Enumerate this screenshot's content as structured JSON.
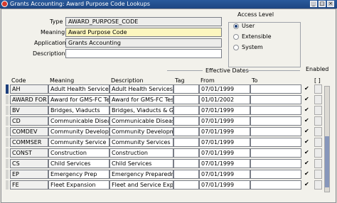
{
  "window": {
    "title": "Grants Accounting: Award Purpose Code Lookups"
  },
  "header": {
    "type_label": "Type",
    "type_value": "AWARD_PURPOSE_CODE",
    "meaning_label": "Meaning",
    "meaning_value": "Award Purpose Code",
    "application_label": "Application",
    "application_value": "Grants Accounting",
    "description_label": "Description",
    "description_value": ""
  },
  "access_level": {
    "title": "Access Level",
    "options": [
      "User",
      "Extensible",
      "System"
    ],
    "selected": "User"
  },
  "table": {
    "group_labels": {
      "effective_dates": "Effective Dates",
      "enabled": "Enabled"
    },
    "columns": {
      "code": "Code",
      "meaning": "Meaning",
      "description": "Description",
      "tag": "Tag",
      "from": "From",
      "to": "To",
      "extra": "[ ]"
    },
    "rows": [
      {
        "code": "AH",
        "meaning": "Adult Health Services",
        "description": "Adult Health Services",
        "tag": "",
        "from": "07/01/1999",
        "to": "",
        "enabled": true
      },
      {
        "code": "AWARD FOR",
        "meaning": "Award for GMS-FC Te:",
        "description": "Award for GMS-FC Test",
        "tag": "",
        "from": "01/01/2002",
        "to": "",
        "enabled": true
      },
      {
        "code": "BV",
        "meaning": "Bridges, Viaducts",
        "description": "Bridges, Viaducts & Gra",
        "tag": "",
        "from": "07/01/1999",
        "to": "",
        "enabled": true
      },
      {
        "code": "CD",
        "meaning": "Communicable Disease",
        "description": "Communicable Disease",
        "tag": "",
        "from": "07/01/1999",
        "to": "",
        "enabled": true
      },
      {
        "code": "COMDEV",
        "meaning": "Community Developme",
        "description": "Community Developmen",
        "tag": "",
        "from": "07/01/1999",
        "to": "",
        "enabled": true
      },
      {
        "code": "COMMSER",
        "meaning": "Community Service",
        "description": "Community Services",
        "tag": "",
        "from": "07/01/1999",
        "to": "",
        "enabled": true
      },
      {
        "code": "CONST",
        "meaning": "Construction",
        "description": "Construction",
        "tag": "",
        "from": "07/01/1999",
        "to": "",
        "enabled": true
      },
      {
        "code": "CS",
        "meaning": "Child Services",
        "description": "Child Services",
        "tag": "",
        "from": "07/01/1999",
        "to": "",
        "enabled": true
      },
      {
        "code": "EP",
        "meaning": "Emergency Prep",
        "description": "Emergency Preparedne",
        "tag": "",
        "from": "07/01/1999",
        "to": "",
        "enabled": true
      },
      {
        "code": "FE",
        "meaning": "Fleet Expansion",
        "description": "Fleet and Service Expar",
        "tag": "",
        "from": "07/01/1999",
        "to": "",
        "enabled": true
      }
    ]
  }
}
